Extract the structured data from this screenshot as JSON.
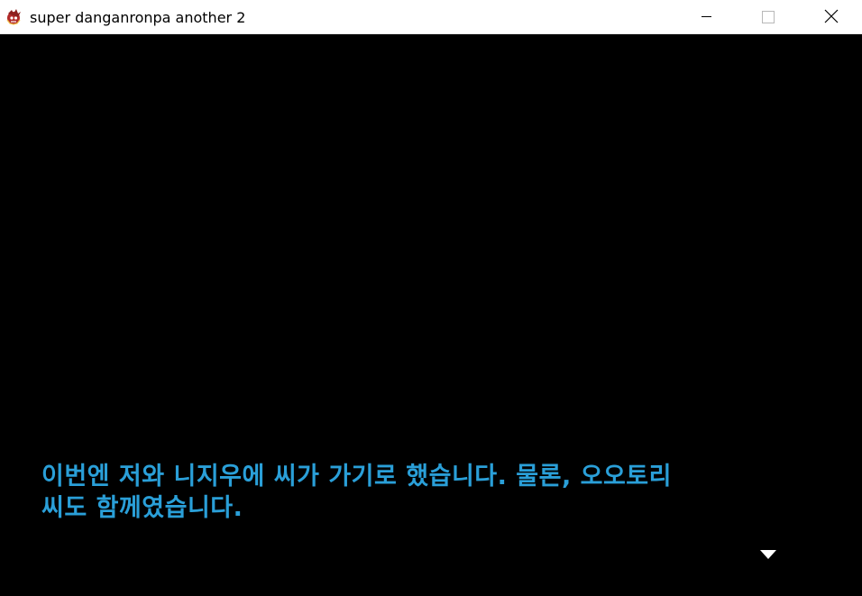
{
  "window": {
    "title": "super danganronpa another 2",
    "icon": "danganronpa-app-icon",
    "controls": {
      "minimize_icon": "minimize-icon",
      "maximize_icon": "maximize-icon",
      "close_icon": "close-icon"
    }
  },
  "game": {
    "background_color": "#000000",
    "dialogue": {
      "line1": "이번엔 저와 니지우에 씨가 가기로 했습니다. 물론, 오오토리",
      "line2": "씨도 함께였습니다.",
      "text_color": "#2a9fd8"
    },
    "advance_indicator": "triangle-down-icon",
    "advance_indicator_color": "#ffffff"
  }
}
